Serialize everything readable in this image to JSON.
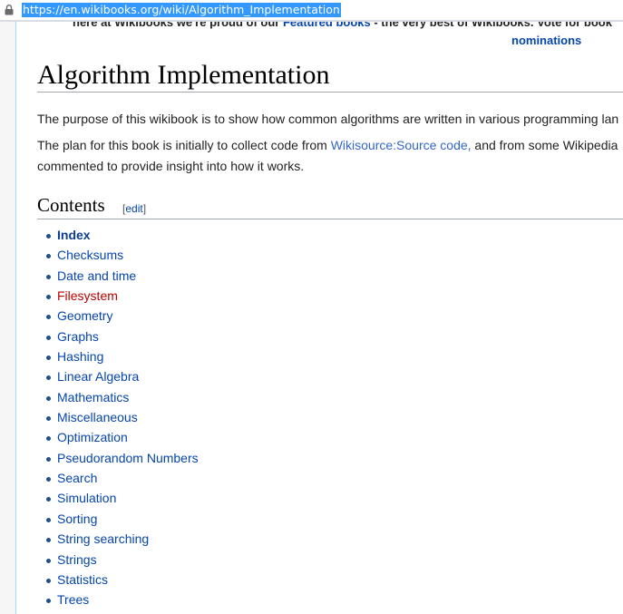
{
  "browser": {
    "url": "https://en.wikibooks.org/wiki/Algorithm_Implementation"
  },
  "notice": {
    "prefix": "here at Wikibooks we're proud of our ",
    "featured_link": "Featured books",
    "suffix": " - the very best of Wikibooks. Vote for book",
    "nominations_link": "nominations"
  },
  "page": {
    "title": "Algorithm Implementation",
    "intro": "The purpose of this wikibook is to show how common algorithms are written in various programming lan",
    "plan_prefix": "The plan for this book is initially to collect code from ",
    "plan_link": "Wikisource:Source code,",
    "plan_suffix": " and from some Wikipedia",
    "plan_line2": "commented to provide insight into how it works."
  },
  "contents": {
    "heading": "Contents",
    "edit_open": "[",
    "edit_label": "edit",
    "edit_close": "]",
    "items": [
      {
        "label": "Index"
      },
      {
        "label": "Checksums"
      },
      {
        "label": "Date and time"
      },
      {
        "label": "Filesystem"
      },
      {
        "label": "Geometry"
      },
      {
        "label": "Graphs"
      },
      {
        "label": "Hashing"
      },
      {
        "label": "Linear Algebra"
      },
      {
        "label": "Mathematics"
      },
      {
        "label": "Miscellaneous"
      },
      {
        "label": "Optimization"
      },
      {
        "label": "Pseudorandom Numbers"
      },
      {
        "label": "Search"
      },
      {
        "label": "Simulation"
      },
      {
        "label": "Sorting"
      },
      {
        "label": "String searching"
      },
      {
        "label": "Strings"
      },
      {
        "label": "Statistics"
      },
      {
        "label": "Trees"
      }
    ]
  },
  "colors": {
    "link": "#0645ad",
    "new_link": "#ba0000",
    "url_highlight": "#3399ff"
  }
}
